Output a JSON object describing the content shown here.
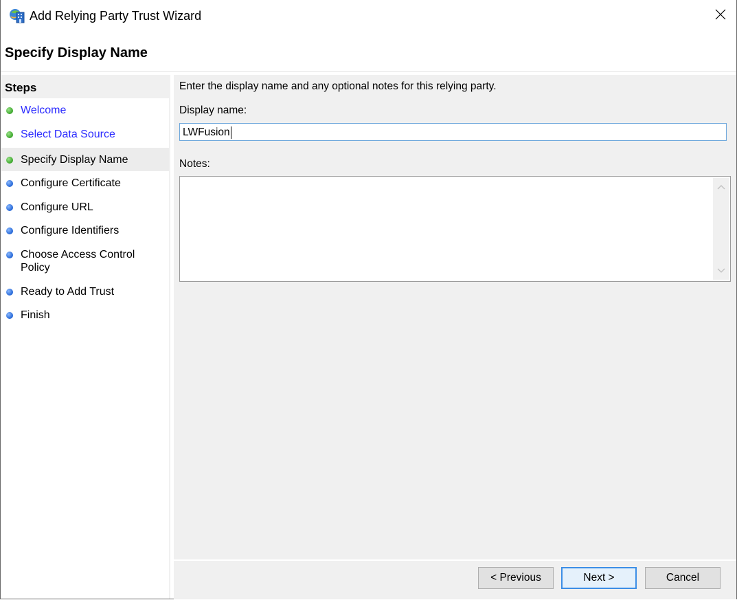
{
  "window": {
    "title": "Add Relying Party Trust Wizard",
    "app_icon": "adfs-wizard-icon",
    "close_icon": "close-icon"
  },
  "header": {
    "page_title": "Specify Display Name"
  },
  "sidebar": {
    "heading": "Steps",
    "items": [
      {
        "label": "Welcome",
        "status": "completed",
        "dot_color": "#3aa52a",
        "link": true
      },
      {
        "label": "Select Data Source",
        "status": "completed",
        "dot_color": "#3aa52a",
        "link": true
      },
      {
        "label": "Specify Display Name",
        "status": "current",
        "dot_color": "#3aa52a",
        "link": false
      },
      {
        "label": "Configure Certificate",
        "status": "pending",
        "dot_color": "#2466d6",
        "link": false
      },
      {
        "label": "Configure URL",
        "status": "pending",
        "dot_color": "#2466d6",
        "link": false
      },
      {
        "label": "Configure Identifiers",
        "status": "pending",
        "dot_color": "#2466d6",
        "link": false
      },
      {
        "label": "Choose Access Control Policy",
        "status": "pending",
        "dot_color": "#2466d6",
        "link": false
      },
      {
        "label": "Ready to Add Trust",
        "status": "pending",
        "dot_color": "#2466d6",
        "link": false
      },
      {
        "label": "Finish",
        "status": "pending",
        "dot_color": "#2466d6",
        "link": false
      }
    ]
  },
  "main": {
    "instruction": "Enter the display name and any optional notes for this relying party.",
    "display_name_label": "Display name:",
    "display_name_value": "LWFusion",
    "notes_label": "Notes:",
    "notes_value": ""
  },
  "footer": {
    "previous_label": "< Previous",
    "next_label": "Next >",
    "cancel_label": "Cancel"
  },
  "colors": {
    "link": "#2a2aff",
    "focus_border": "#3c8ee6",
    "panel_bg": "#f0f0f0"
  }
}
